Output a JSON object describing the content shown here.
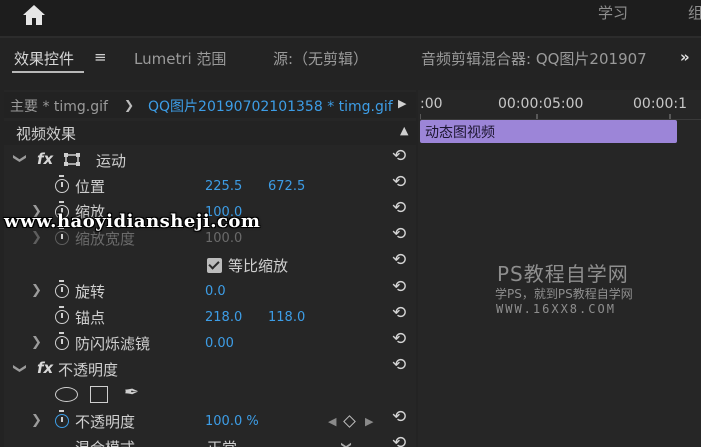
{
  "workspaces": [
    "学习",
    "组"
  ],
  "tabs": {
    "effect_controls": "效果控件",
    "menu_glyph": "≡",
    "lumetri": "Lumetri 范围",
    "source": "源:（无剪辑）",
    "audio_mixer": "音频剪辑混合器: QQ图片201907",
    "more": "»"
  },
  "clip_selector": {
    "master": "主要 * timg.gif",
    "sequence": "QQ图片20190702101358 * timg.gif"
  },
  "timeline": {
    "timecodes": [
      ":00",
      "00:00:05:00",
      "00:00:1"
    ],
    "clip_name": "动态图视频"
  },
  "section_title": "视频效果",
  "motion": {
    "name": "运动",
    "position": {
      "label": "位置",
      "x": "225.5",
      "y": "672.5"
    },
    "scale": {
      "label": "缩放",
      "value": "100.0"
    },
    "scale_width": {
      "label": "缩放宽度",
      "value": "100.0"
    },
    "uniform_scale": {
      "label": "等比缩放",
      "checked": true
    },
    "rotation": {
      "label": "旋转",
      "value": "0.0"
    },
    "anchor": {
      "label": "锚点",
      "x": "218.0",
      "y": "118.0"
    },
    "anti_flicker": {
      "label": "防闪烁滤镜",
      "value": "0.00"
    }
  },
  "opacity": {
    "name": "不透明度",
    "opacity": {
      "label": "不透明度",
      "value": "100.0 %"
    },
    "blend": {
      "label": "混合模式",
      "value": "正常"
    }
  },
  "watermarks": {
    "url": "www.haoyidiansheji.com",
    "ps_title": "PS教程自学网",
    "ps_sub": "学PS，就到PS教程自学网",
    "ps_url": "WWW.16XX8.COM"
  },
  "colors": {
    "accent_blue": "#3d9de6",
    "clip_purple": "#9c85d8",
    "background": "#232323"
  }
}
